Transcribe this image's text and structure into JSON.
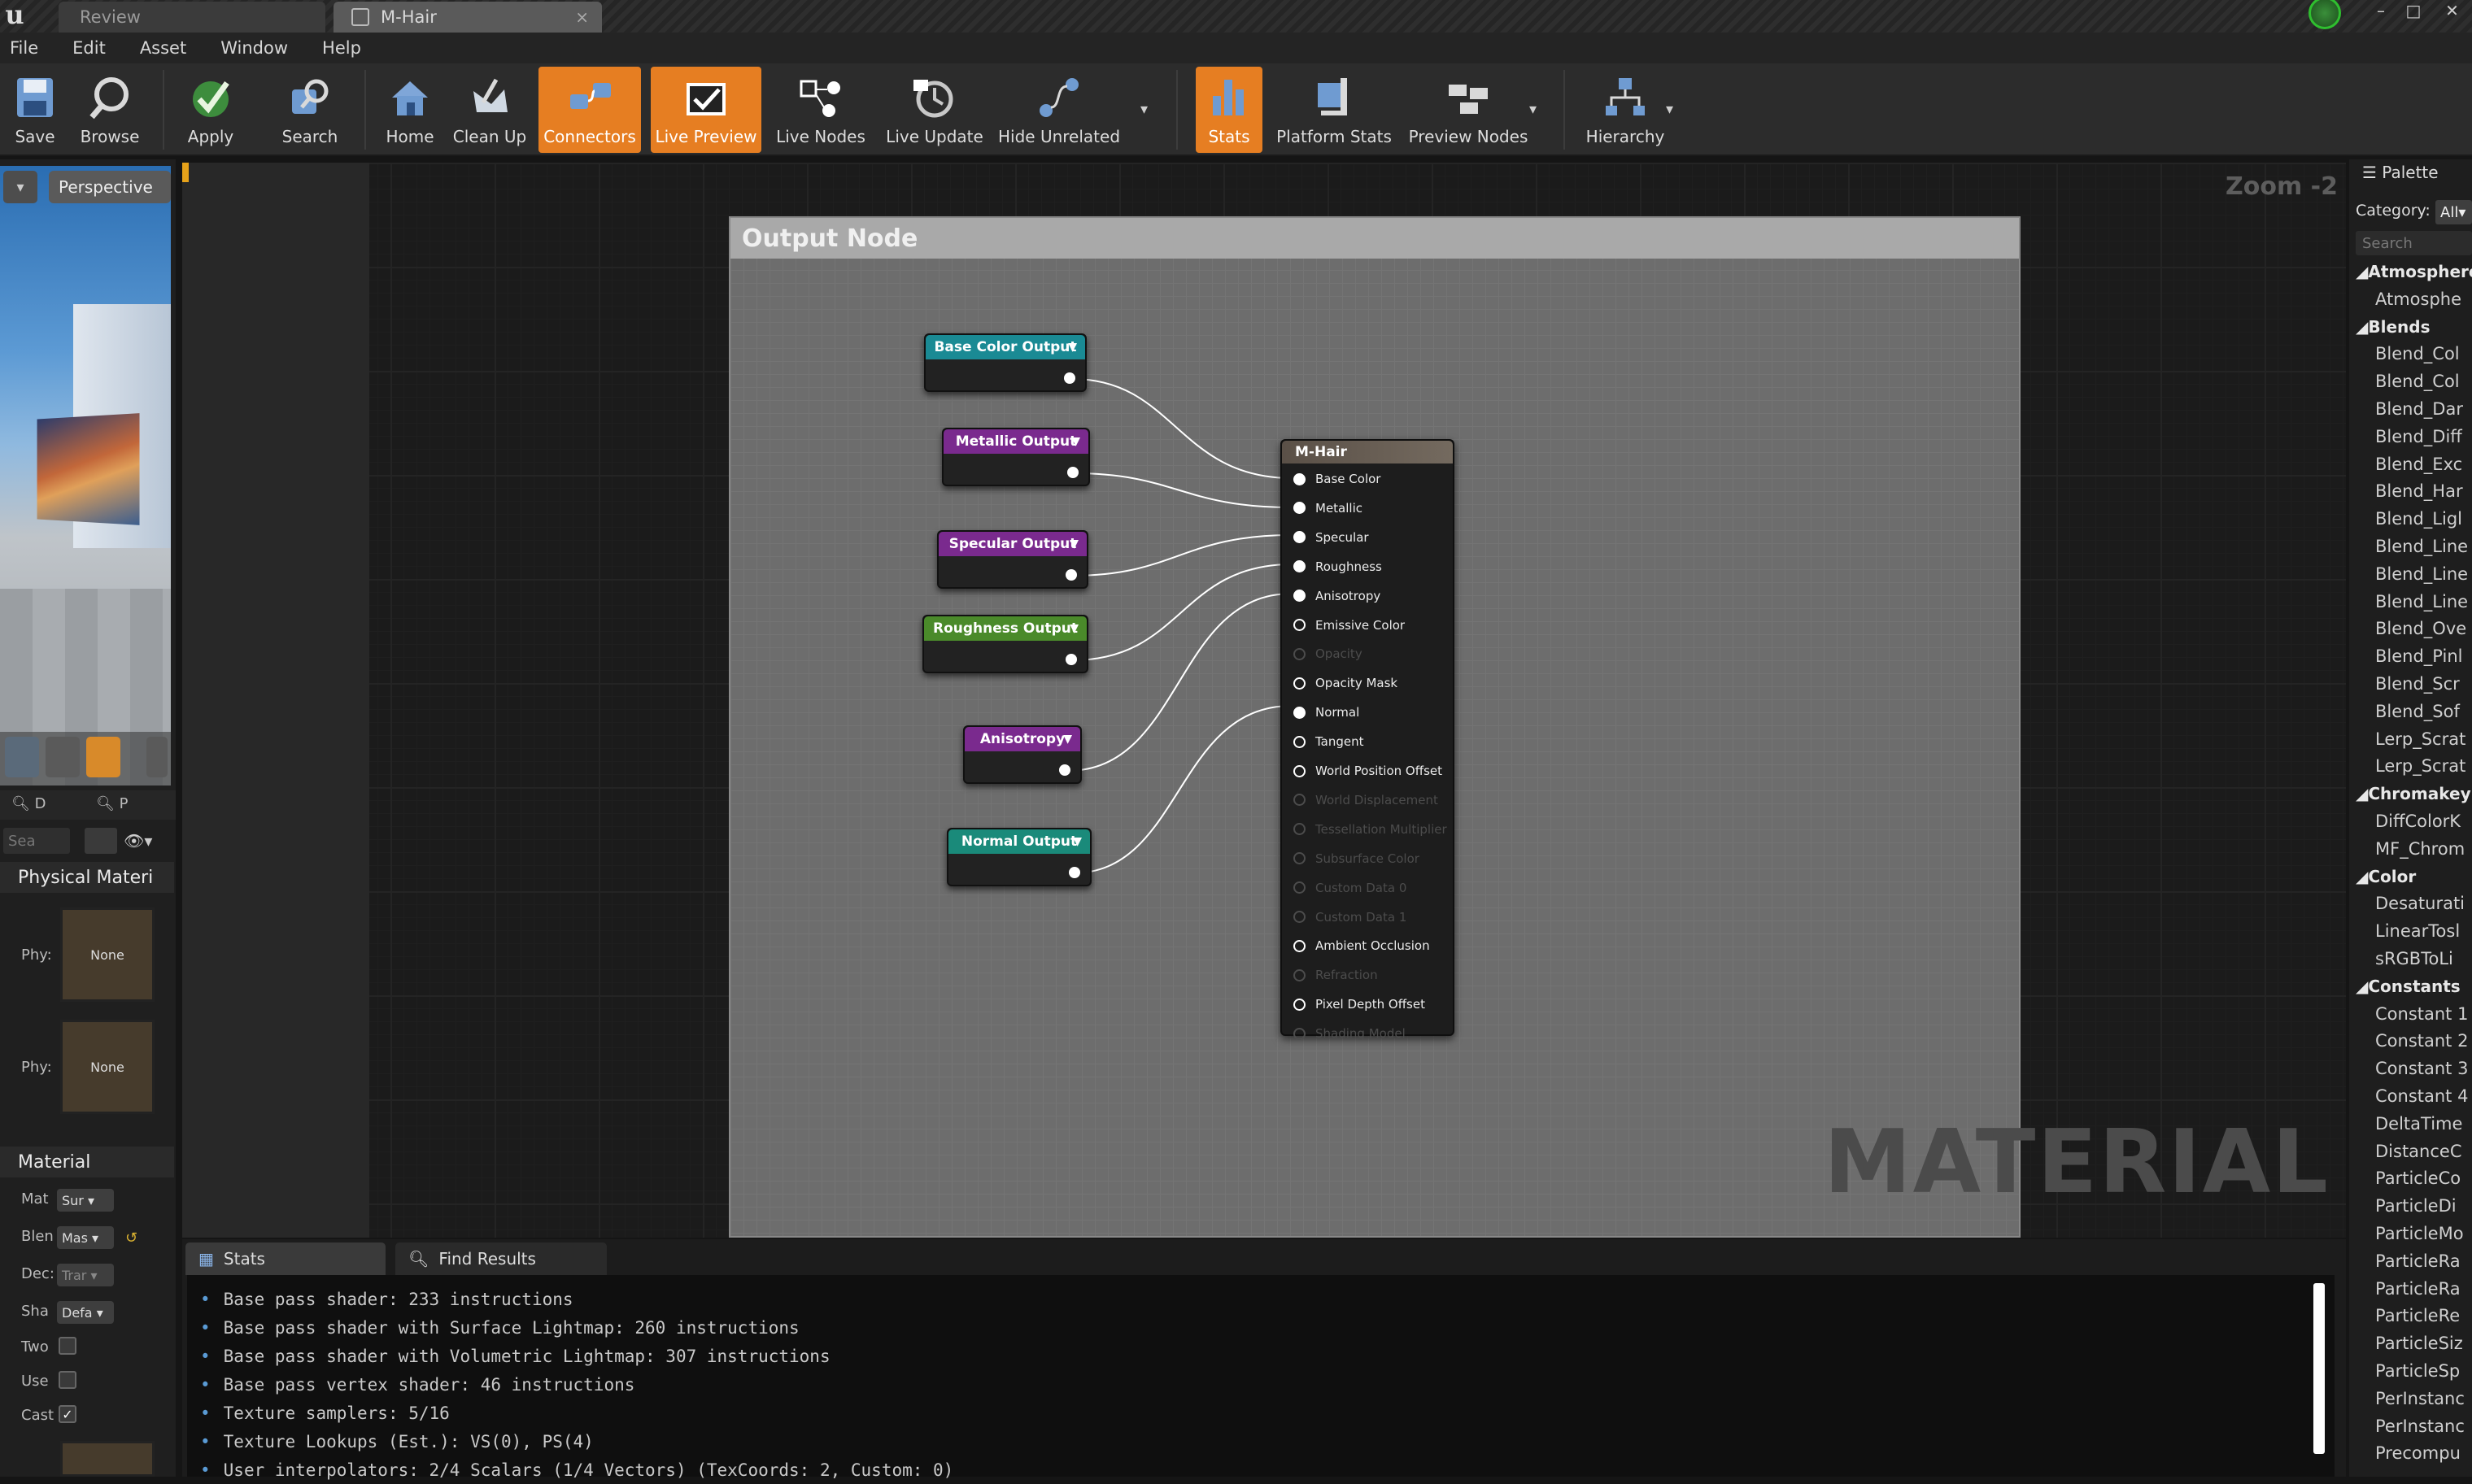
{
  "tabs": [
    {
      "label": "Review"
    },
    {
      "label": "M-Hair"
    }
  ],
  "menu": [
    "File",
    "Edit",
    "Asset",
    "Window",
    "Help"
  ],
  "toolbar": {
    "items": [
      {
        "label": "Save",
        "icon": "save-icon"
      },
      {
        "label": "Browse",
        "icon": "browse-icon"
      },
      {
        "label": "Apply",
        "icon": "apply-icon"
      },
      {
        "label": "Search",
        "icon": "search-icon"
      },
      {
        "label": "Home",
        "icon": "home-icon"
      },
      {
        "label": "Clean Up",
        "icon": "clean-up-icon"
      },
      {
        "label": "Connectors",
        "icon": "connectors-icon",
        "active": true
      },
      {
        "label": "Live Preview",
        "icon": "live-preview-icon",
        "active": true
      },
      {
        "label": "Live Nodes",
        "icon": "live-nodes-icon"
      },
      {
        "label": "Live Update",
        "icon": "live-update-icon"
      },
      {
        "label": "Hide Unrelated",
        "icon": "hide-unrelated-icon"
      },
      {
        "label": "Stats",
        "icon": "stats-icon",
        "active": true
      },
      {
        "label": "Platform Stats",
        "icon": "platform-stats-icon"
      },
      {
        "label": "Preview Nodes",
        "icon": "preview-nodes-icon"
      },
      {
        "label": "Hierarchy",
        "icon": "hierarchy-icon"
      }
    ],
    "accent": "#e67e22"
  },
  "viewport": {
    "mode_label": "Perspective"
  },
  "details": {
    "tab_d": "D",
    "tab_p": "P",
    "search_placeholder": "Sea",
    "physical_section": "Physical Materi",
    "phys_label_1": "Phy:",
    "phys_value_1": "None",
    "phys_label_2": "Phy:",
    "phys_value_2": "None",
    "material_section": "Material",
    "rows": [
      {
        "label": "Mat",
        "value": "Sur"
      },
      {
        "label": "Blen",
        "value": "Mas"
      },
      {
        "label": "Dec:",
        "value": "Trar"
      },
      {
        "label": "Sha",
        "value": "Defa"
      }
    ],
    "checks": [
      {
        "label": "Two",
        "checked": false
      },
      {
        "label": "Use",
        "checked": false
      },
      {
        "label": "Cast",
        "checked": true
      }
    ]
  },
  "graph": {
    "zoom": "Zoom -2",
    "watermark": "MATERIAL",
    "comment_title": "Output Node",
    "nodes": [
      {
        "label": "Base Color Output",
        "color": "#1a8a94"
      },
      {
        "label": "Metallic Output",
        "color": "#7a2a8e"
      },
      {
        "label": "Specular Output",
        "color": "#7a2a8e"
      },
      {
        "label": "Roughness Output",
        "color": "#4a8a2a"
      },
      {
        "label": "Anisotropy",
        "color": "#7a2a8e"
      },
      {
        "label": "Normal Output",
        "color": "#1a8a7a"
      }
    ],
    "material_node": {
      "title": "M-Hair",
      "inputs": [
        {
          "label": "Base Color",
          "enabled": true,
          "connected": true
        },
        {
          "label": "Metallic",
          "enabled": true,
          "connected": true
        },
        {
          "label": "Specular",
          "enabled": true,
          "connected": true
        },
        {
          "label": "Roughness",
          "enabled": true,
          "connected": true
        },
        {
          "label": "Anisotropy",
          "enabled": true,
          "connected": true
        },
        {
          "label": "Emissive Color",
          "enabled": true,
          "connected": false
        },
        {
          "label": "Opacity",
          "enabled": false,
          "connected": false
        },
        {
          "label": "Opacity Mask",
          "enabled": true,
          "connected": false
        },
        {
          "label": "Normal",
          "enabled": true,
          "connected": true
        },
        {
          "label": "Tangent",
          "enabled": true,
          "connected": false
        },
        {
          "label": "World Position Offset",
          "enabled": true,
          "connected": false
        },
        {
          "label": "World Displacement",
          "enabled": false,
          "connected": false
        },
        {
          "label": "Tessellation Multiplier",
          "enabled": false,
          "connected": false
        },
        {
          "label": "Subsurface Color",
          "enabled": false,
          "connected": false
        },
        {
          "label": "Custom Data 0",
          "enabled": false,
          "connected": false
        },
        {
          "label": "Custom Data 1",
          "enabled": false,
          "connected": false
        },
        {
          "label": "Ambient Occlusion",
          "enabled": true,
          "connected": false
        },
        {
          "label": "Refraction",
          "enabled": false,
          "connected": false
        },
        {
          "label": "Pixel Depth Offset",
          "enabled": true,
          "connected": false
        },
        {
          "label": "Shading Model",
          "enabled": false,
          "connected": false
        }
      ]
    }
  },
  "bottom": {
    "tab_stats": "Stats",
    "tab_find": "Find Results",
    "stats_lines": [
      "Base pass shader: 233 instructions",
      "Base pass shader with Surface Lightmap: 260 instructions",
      "Base pass shader with Volumetric Lightmap: 307 instructions",
      "Base pass vertex shader: 46 instructions",
      "Texture samplers: 5/16",
      "Texture Lookups (Est.): VS(0), PS(4)",
      "User interpolators: 2/4 Scalars (1/4 Vectors) (TexCoords: 2, Custom: 0)"
    ]
  },
  "palette": {
    "tab": "Palette",
    "category_label": "Category:",
    "category_value": "All",
    "search_placeholder": "Search",
    "items": [
      {
        "text": "Atmosphere",
        "cat": true
      },
      {
        "text": "Atmosphe",
        "cat": false
      },
      {
        "text": "Blends",
        "cat": true
      },
      {
        "text": "Blend_Col",
        "cat": false
      },
      {
        "text": "Blend_Col",
        "cat": false
      },
      {
        "text": "Blend_Dar",
        "cat": false
      },
      {
        "text": "Blend_Diff",
        "cat": false
      },
      {
        "text": "Blend_Exc",
        "cat": false
      },
      {
        "text": "Blend_Har",
        "cat": false
      },
      {
        "text": "Blend_Ligl",
        "cat": false
      },
      {
        "text": "Blend_Line",
        "cat": false
      },
      {
        "text": "Blend_Line",
        "cat": false
      },
      {
        "text": "Blend_Line",
        "cat": false
      },
      {
        "text": "Blend_Ove",
        "cat": false
      },
      {
        "text": "Blend_Pinl",
        "cat": false
      },
      {
        "text": "Blend_Scr",
        "cat": false
      },
      {
        "text": "Blend_Sof",
        "cat": false
      },
      {
        "text": "Lerp_Scrat",
        "cat": false
      },
      {
        "text": "Lerp_Scrat",
        "cat": false
      },
      {
        "text": "Chromakeyin",
        "cat": true
      },
      {
        "text": "DiffColorK",
        "cat": false
      },
      {
        "text": "MF_Chrom",
        "cat": false
      },
      {
        "text": "Color",
        "cat": true
      },
      {
        "text": "Desaturati",
        "cat": false
      },
      {
        "text": "LinearTosl",
        "cat": false
      },
      {
        "text": "sRGBToLi",
        "cat": false
      },
      {
        "text": "Constants",
        "cat": true
      },
      {
        "text": "Constant 1",
        "cat": false
      },
      {
        "text": "Constant 2",
        "cat": false
      },
      {
        "text": "Constant 3",
        "cat": false
      },
      {
        "text": "Constant 4",
        "cat": false
      },
      {
        "text": "DeltaTime",
        "cat": false
      },
      {
        "text": "DistanceC",
        "cat": false
      },
      {
        "text": "ParticleCo",
        "cat": false
      },
      {
        "text": "ParticleDi",
        "cat": false
      },
      {
        "text": "ParticleMo",
        "cat": false
      },
      {
        "text": "ParticleRa",
        "cat": false
      },
      {
        "text": "ParticleRa",
        "cat": false
      },
      {
        "text": "ParticleRe",
        "cat": false
      },
      {
        "text": "ParticleSiz",
        "cat": false
      },
      {
        "text": "ParticleSp",
        "cat": false
      },
      {
        "text": "PerInstanc",
        "cat": false
      },
      {
        "text": "PerInstanc",
        "cat": false
      },
      {
        "text": "Precompu",
        "cat": false
      }
    ]
  }
}
